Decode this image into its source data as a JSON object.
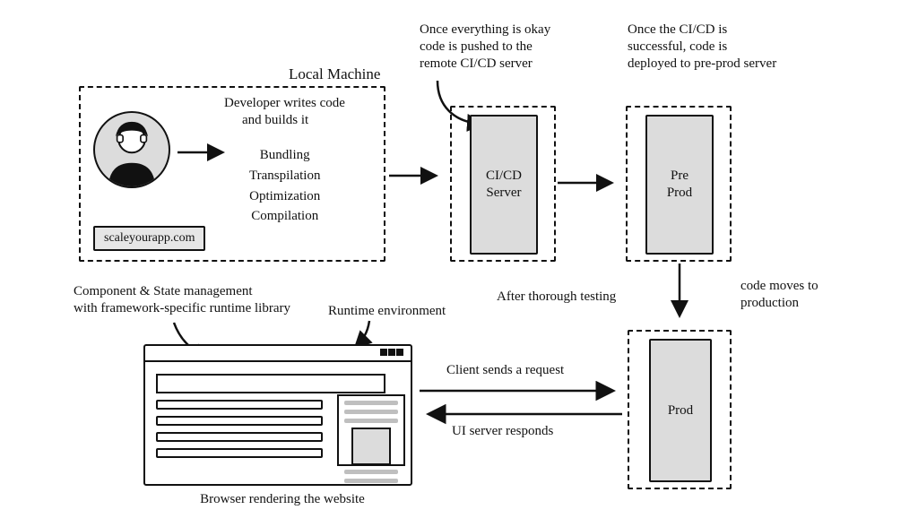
{
  "local": {
    "title": "Local Machine",
    "dev_line1": "Developer writes code",
    "dev_line2": "and builds it",
    "steps": [
      "Bundling",
      "Transpilation",
      "Optimization",
      "Compilation"
    ],
    "site_badge": "scaleyourapp.com"
  },
  "ci": {
    "label": "CI/CD\nServer",
    "note": "Once everything is okay\ncode is pushed to the\nremote CI/CD server"
  },
  "preprod": {
    "label": "Pre\nProd",
    "note": "Once the CI/CD is\nsuccessful, code is\ndeployed to pre-prod server"
  },
  "to_prod": {
    "left_note": "After thorough testing",
    "right_note": "code moves to\nproduction"
  },
  "prod": {
    "label": "Prod"
  },
  "requests": {
    "to_server": "Client sends a request",
    "to_client": "UI server responds"
  },
  "browser": {
    "caption": "Browser rendering the website",
    "note_component": "Component & State management\nwith framework-specific runtime library",
    "note_runtime": "Runtime environment"
  }
}
